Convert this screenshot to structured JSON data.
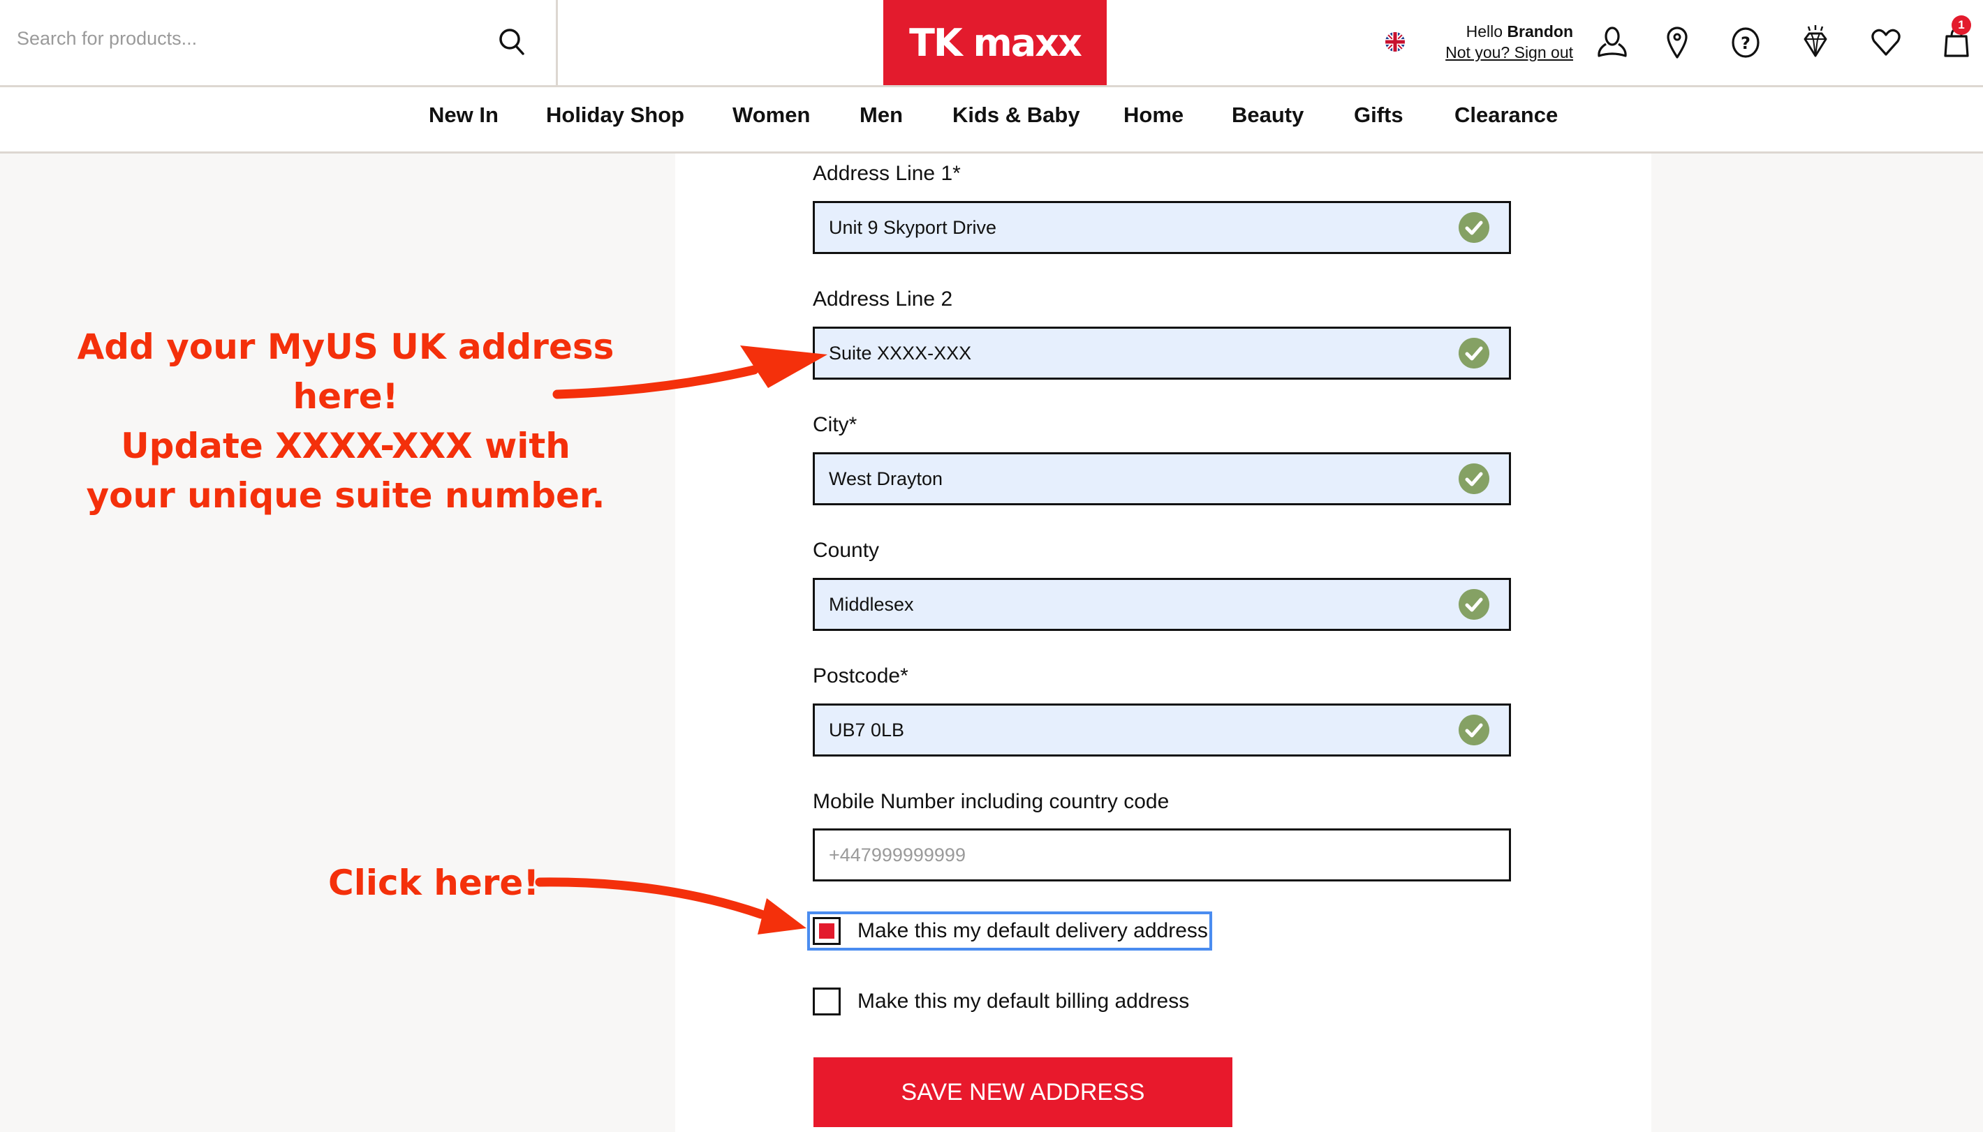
{
  "header": {
    "search": {
      "placeholder": "Search for products...",
      "icon": "search-icon"
    },
    "logo_text": "TK maxx",
    "brand_color": "#e31b2d",
    "region_icon": "uk-flag-icon",
    "greeting_prefix": "Hello",
    "user_name": "Brandon",
    "sign_out_label": "Not you? Sign out",
    "icons": [
      "account-icon",
      "store-locator-icon",
      "help-icon",
      "gold-label-diamond-icon",
      "wishlist-heart-icon",
      "shopping-bag-icon"
    ],
    "bag_count": "1"
  },
  "nav": {
    "items": [
      "New In",
      "Holiday Shop",
      "Women",
      "Men",
      "Kids & Baby",
      "Home",
      "Beauty",
      "Gifts",
      "Clearance"
    ]
  },
  "form": {
    "fields": [
      {
        "label": "Address Line 1*",
        "value": "Unit 9 Skyport Drive",
        "valid": true
      },
      {
        "label": "Address Line 2",
        "value": "Suite XXXX-XXX",
        "valid": true
      },
      {
        "label": "City*",
        "value": "West Drayton",
        "valid": true
      },
      {
        "label": "County",
        "value": "Middlesex",
        "valid": true
      },
      {
        "label": "Postcode*",
        "value": "UB7 0LB",
        "valid": true
      },
      {
        "label": "Mobile Number including country code",
        "value": "",
        "placeholder": "+447999999999",
        "valid": false
      }
    ],
    "checkboxes": [
      {
        "label": "Make this my default delivery address",
        "checked": true,
        "focused": true
      },
      {
        "label": "Make this my default billing address",
        "checked": false,
        "focused": false
      }
    ],
    "save_label": "SAVE NEW ADDRESS",
    "valid_color": "#85a164",
    "filled_bg_color": "#e6effd"
  },
  "annotations": {
    "suite_note": [
      "Add your MyUS UK address here!",
      "Update XXXX-XXX with",
      "your unique suite number."
    ],
    "click_note": "Click here!",
    "color": "#f4300b"
  }
}
